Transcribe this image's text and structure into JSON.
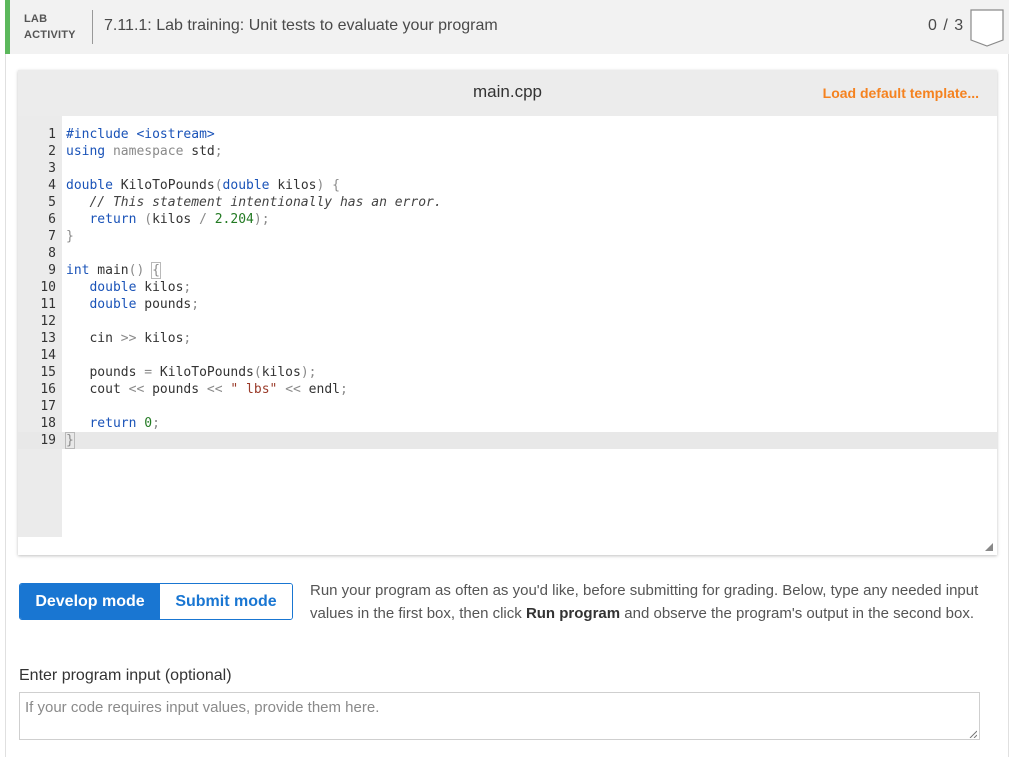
{
  "header": {
    "lab_label_line1": "LAB",
    "lab_label_line2": "ACTIVITY",
    "title": "7.11.1: Lab training: Unit tests to evaluate your program",
    "score": "0 / 3",
    "accent_color": "#5cb85c"
  },
  "editor": {
    "filename": "main.cpp",
    "load_template_label": "Load default template...",
    "line_numbers": [
      "1",
      "2",
      "3",
      "4",
      "5",
      "6",
      "7",
      "8",
      "9",
      "10",
      "11",
      "12",
      "13",
      "14",
      "15",
      "16",
      "17",
      "18",
      "19"
    ],
    "code_lines": [
      "#include <iostream>",
      "using namespace std;",
      "",
      "double KiloToPounds(double kilos) {",
      "   // This statement intentionally has an error.",
      "   return (kilos / 2.204);",
      "}",
      "",
      "int main() {",
      "   double kilos;",
      "   double pounds;",
      "",
      "   cin >> kilos;",
      "",
      "   pounds = KiloToPounds(kilos);",
      "   cout << pounds << \" lbs\" << endl;",
      "",
      "   return 0;",
      "}"
    ],
    "active_line": "19"
  },
  "modes": {
    "develop_label": "Develop mode",
    "submit_label": "Submit mode",
    "active": "Develop mode",
    "active_color": "#1976d2"
  },
  "instructions": {
    "part1": "Run your program as often as you'd like, before submitting for grading. Below, type any needed input values in the first box, then click ",
    "bold": "Run program",
    "part2": " and observe the program's output in the second box."
  },
  "input": {
    "label": "Enter program input (optional)",
    "placeholder": "If your code requires input values, provide them here.",
    "value": ""
  },
  "colors": {
    "load_template": "#f5821f",
    "keyword": "#1a53b8",
    "number": "#237a23"
  }
}
